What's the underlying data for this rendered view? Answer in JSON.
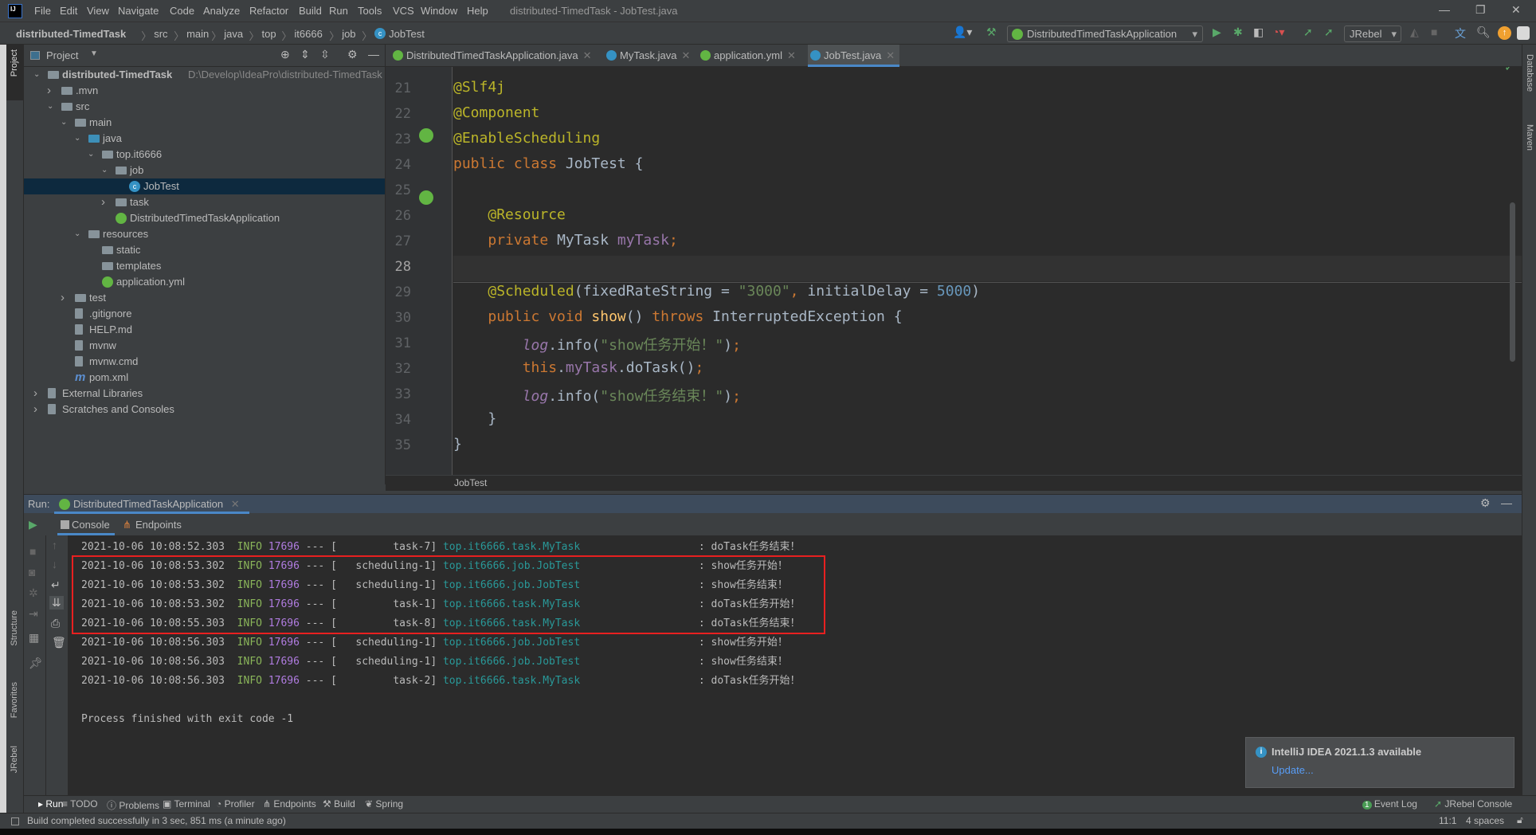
{
  "titlebar": {
    "menus": [
      "File",
      "Edit",
      "View",
      "Navigate",
      "Code",
      "Analyze",
      "Refactor",
      "Build",
      "Run",
      "Tools",
      "VCS",
      "Window",
      "Help"
    ],
    "title": "distributed-TimedTask - JobTest.java"
  },
  "navbar": {
    "breadcrumbs": [
      "distributed-TimedTask",
      "src",
      "main",
      "java",
      "top",
      "it6666",
      "job",
      "JobTest"
    ],
    "run_config": "DistributedTimedTaskApplication",
    "jrebel": "JRebel"
  },
  "project": {
    "header": "Project",
    "tree": [
      {
        "label": "distributed-TimedTask",
        "path": "D:\\Develop\\IdeaPro\\distributed-TimedTask",
        "level": 0,
        "arrow": "open",
        "icon": "module"
      },
      {
        "label": ".mvn",
        "level": 1,
        "arrow": "closed",
        "icon": "folder"
      },
      {
        "label": "src",
        "level": 1,
        "arrow": "open",
        "icon": "folder"
      },
      {
        "label": "main",
        "level": 2,
        "arrow": "open",
        "icon": "folder"
      },
      {
        "label": "java",
        "level": 3,
        "arrow": "open",
        "icon": "source-folder"
      },
      {
        "label": "top.it6666",
        "level": 4,
        "arrow": "open",
        "icon": "package"
      },
      {
        "label": "job",
        "level": 5,
        "arrow": "open",
        "icon": "package"
      },
      {
        "label": "JobTest",
        "level": 6,
        "arrow": "",
        "icon": "class",
        "selected": true
      },
      {
        "label": "task",
        "level": 5,
        "arrow": "closed",
        "icon": "package"
      },
      {
        "label": "DistributedTimedTaskApplication",
        "level": 5,
        "arrow": "",
        "icon": "spring-class"
      },
      {
        "label": "resources",
        "level": 3,
        "arrow": "open",
        "icon": "resources-folder"
      },
      {
        "label": "static",
        "level": 4,
        "arrow": "",
        "icon": "folder"
      },
      {
        "label": "templates",
        "level": 4,
        "arrow": "",
        "icon": "folder"
      },
      {
        "label": "application.yml",
        "level": 4,
        "arrow": "",
        "icon": "spring-config"
      },
      {
        "label": "test",
        "level": 2,
        "arrow": "closed",
        "icon": "folder"
      },
      {
        "label": ".gitignore",
        "level": 2,
        "arrow": "",
        "icon": "file"
      },
      {
        "label": "HELP.md",
        "level": 2,
        "arrow": "",
        "icon": "markdown"
      },
      {
        "label": "mvnw",
        "level": 2,
        "arrow": "",
        "icon": "script"
      },
      {
        "label": "mvnw.cmd",
        "level": 2,
        "arrow": "",
        "icon": "file"
      },
      {
        "label": "pom.xml",
        "level": 2,
        "arrow": "",
        "icon": "maven"
      },
      {
        "label": "External Libraries",
        "level": 0,
        "arrow": "closed",
        "icon": "libraries"
      },
      {
        "label": "Scratches and Consoles",
        "level": 0,
        "arrow": "closed",
        "icon": "scratches"
      }
    ]
  },
  "editor": {
    "tabs": [
      {
        "label": "DistributedTimedTaskApplication.java",
        "icon": "spring"
      },
      {
        "label": "MyTask.java",
        "icon": "class"
      },
      {
        "label": "application.yml",
        "icon": "spring"
      },
      {
        "label": "JobTest.java",
        "icon": "class",
        "active": true
      }
    ],
    "lines": [
      {
        "n": "21",
        "tokens": [
          {
            "t": "@Slf4j",
            "c": "a"
          }
        ]
      },
      {
        "n": "22",
        "tokens": [
          {
            "t": "@Component",
            "c": "a"
          }
        ]
      },
      {
        "n": "23",
        "tokens": [
          {
            "t": "@EnableScheduling",
            "c": "a"
          }
        ]
      },
      {
        "n": "24",
        "tokens": [
          {
            "t": "public class ",
            "c": "k"
          },
          {
            "t": "JobTest {",
            "c": "p"
          }
        ]
      },
      {
        "n": "25",
        "tokens": []
      },
      {
        "n": "26",
        "tokens": [
          {
            "t": "    ",
            "c": "p"
          },
          {
            "t": "@Resource",
            "c": "a"
          }
        ]
      },
      {
        "n": "27",
        "tokens": [
          {
            "t": "    ",
            "c": "p"
          },
          {
            "t": "private ",
            "c": "k"
          },
          {
            "t": "MyTask ",
            "c": "p"
          },
          {
            "t": "myTask",
            "c": "f"
          },
          {
            "t": ";",
            "c": "k"
          }
        ]
      },
      {
        "n": "28",
        "tokens": []
      },
      {
        "n": "29",
        "tokens": [
          {
            "t": "    ",
            "c": "p"
          },
          {
            "t": "@Scheduled",
            "c": "a"
          },
          {
            "t": "(fixedRateString = ",
            "c": "p"
          },
          {
            "t": "\"3000\"",
            "c": "s"
          },
          {
            "t": ", ",
            "c": "k"
          },
          {
            "t": "initialDelay = ",
            "c": "p"
          },
          {
            "t": "5000",
            "c": "n"
          },
          {
            "t": ")",
            "c": "p"
          }
        ]
      },
      {
        "n": "30",
        "tokens": [
          {
            "t": "    ",
            "c": "p"
          },
          {
            "t": "public void ",
            "c": "k"
          },
          {
            "t": "show",
            "c": "m"
          },
          {
            "t": "() ",
            "c": "p"
          },
          {
            "t": "throws ",
            "c": "k"
          },
          {
            "t": "InterruptedException {",
            "c": "p"
          }
        ]
      },
      {
        "n": "31",
        "tokens": [
          {
            "t": "        ",
            "c": "p"
          },
          {
            "t": "log",
            "c": "fi"
          },
          {
            "t": ".info(",
            "c": "p"
          },
          {
            "t": "\"show任务开始！\"",
            "c": "s"
          },
          {
            "t": ")",
            "c": "p"
          },
          {
            "t": ";",
            "c": "k"
          }
        ]
      },
      {
        "n": "32",
        "tokens": [
          {
            "t": "        ",
            "c": "p"
          },
          {
            "t": "this",
            "c": "k"
          },
          {
            "t": ".",
            "c": "p"
          },
          {
            "t": "myTask",
            "c": "f"
          },
          {
            "t": ".doTask()",
            "c": "p"
          },
          {
            "t": ";",
            "c": "k"
          }
        ]
      },
      {
        "n": "33",
        "tokens": [
          {
            "t": "        ",
            "c": "p"
          },
          {
            "t": "log",
            "c": "fi"
          },
          {
            "t": ".info(",
            "c": "p"
          },
          {
            "t": "\"show任务结束！\"",
            "c": "s"
          },
          {
            "t": ")",
            "c": "p"
          },
          {
            "t": ";",
            "c": "k"
          }
        ]
      },
      {
        "n": "34",
        "tokens": [
          {
            "t": "    }",
            "c": "p"
          }
        ]
      },
      {
        "n": "35",
        "tokens": [
          {
            "t": "}",
            "c": "p"
          }
        ]
      }
    ],
    "breadcrumb": "JobTest"
  },
  "run": {
    "label": "Run:",
    "tab": "DistributedTimedTaskApplication",
    "console_tab": "Console",
    "endpoints_tab": "Endpoints",
    "log": [
      {
        "ts": "2021-10-06 10:08:52.303",
        "level": "INFO",
        "pid": "17696",
        "sep": "---",
        "thread": "task-7",
        "logger": "top.it6666.task.MyTask",
        "msg": "doTask任务结束！"
      },
      {
        "ts": "2021-10-06 10:08:53.302",
        "level": "INFO",
        "pid": "17696",
        "sep": "---",
        "thread": "scheduling-1",
        "logger": "top.it6666.job.JobTest",
        "msg": "show任务开始！"
      },
      {
        "ts": "2021-10-06 10:08:53.302",
        "level": "INFO",
        "pid": "17696",
        "sep": "---",
        "thread": "scheduling-1",
        "logger": "top.it6666.job.JobTest",
        "msg": "show任务结束！"
      },
      {
        "ts": "2021-10-06 10:08:53.302",
        "level": "INFO",
        "pid": "17696",
        "sep": "---",
        "thread": "task-1",
        "logger": "top.it6666.task.MyTask",
        "msg": "doTask任务开始！"
      },
      {
        "ts": "2021-10-06 10:08:55.303",
        "level": "INFO",
        "pid": "17696",
        "sep": "---",
        "thread": "task-8",
        "logger": "top.it6666.task.MyTask",
        "msg": "doTask任务结束！"
      },
      {
        "ts": "2021-10-06 10:08:56.303",
        "level": "INFO",
        "pid": "17696",
        "sep": "---",
        "thread": "scheduling-1",
        "logger": "top.it6666.job.JobTest",
        "msg": "show任务开始！"
      },
      {
        "ts": "2021-10-06 10:08:56.303",
        "level": "INFO",
        "pid": "17696",
        "sep": "---",
        "thread": "scheduling-1",
        "logger": "top.it6666.job.JobTest",
        "msg": "show任务结束！"
      },
      {
        "ts": "2021-10-06 10:08:56.303",
        "level": "INFO",
        "pid": "17696",
        "sep": "---",
        "thread": "task-2",
        "logger": "top.it6666.task.MyTask",
        "msg": "doTask任务开始！"
      }
    ],
    "exit": "Process finished with exit code -1"
  },
  "notification": {
    "title": "IntelliJ IDEA 2021.1.3 available",
    "action": "Update..."
  },
  "side": {
    "project": "Project",
    "structure": "Structure",
    "favorites": "Favorites",
    "jrebel": "JRebel",
    "database": "Database",
    "maven": "Maven"
  },
  "toolwindows": [
    "Run",
    "TODO",
    "Problems",
    "Terminal",
    "Profiler",
    "Endpoints",
    "Build",
    "Spring"
  ],
  "toolwindows_right": {
    "event_log": "Event Log",
    "event_count": "1",
    "jrebel_console": "JRebel Console"
  },
  "status": {
    "message": "Build completed successfully in 3 sec, 851 ms (a minute ago)",
    "position": "11:1",
    "indent": "4 spaces"
  },
  "colors": {
    "highlight_box": "#e82020",
    "accent": "#4a88c7",
    "selection": "#0d293e"
  }
}
